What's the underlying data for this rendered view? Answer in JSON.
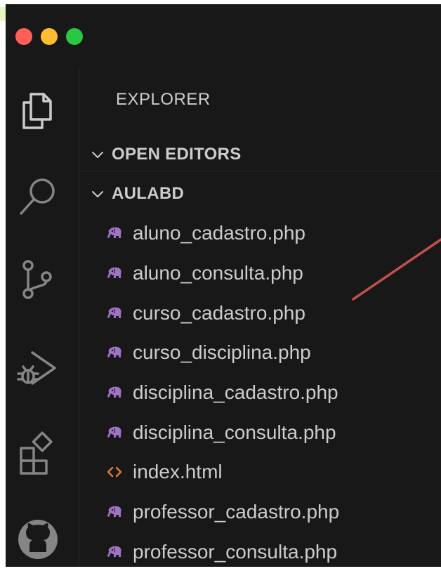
{
  "window": {
    "colors": {
      "background": "#181818",
      "close": "#ff5f57",
      "minimize": "#febc2e",
      "maximize": "#28c840",
      "php_icon": "#a074c4",
      "html_icon": "#e37933",
      "annotation": "#c0504d"
    }
  },
  "activity_bar": {
    "icons": [
      "files-icon",
      "search-icon",
      "source-control-icon",
      "run-debug-icon",
      "extensions-icon",
      "github-icon"
    ]
  },
  "sidebar": {
    "title": "EXPLORER",
    "open_editors": {
      "label": "OPEN EDITORS"
    },
    "project": {
      "label": "AULABD",
      "files": [
        {
          "name": "aluno_cadastro.php",
          "icon": "php-elephant-icon"
        },
        {
          "name": "aluno_consulta.php",
          "icon": "php-elephant-icon"
        },
        {
          "name": "curso_cadastro.php",
          "icon": "php-elephant-icon"
        },
        {
          "name": "curso_disciplina.php",
          "icon": "php-elephant-icon"
        },
        {
          "name": "disciplina_cadastro.php",
          "icon": "php-elephant-icon"
        },
        {
          "name": "disciplina_consulta.php",
          "icon": "php-elephant-icon"
        },
        {
          "name": "index.html",
          "icon": "html-brackets-icon"
        },
        {
          "name": "professor_cadastro.php",
          "icon": "php-elephant-icon"
        },
        {
          "name": "professor_consulta.php",
          "icon": "php-elephant-icon"
        }
      ]
    }
  }
}
